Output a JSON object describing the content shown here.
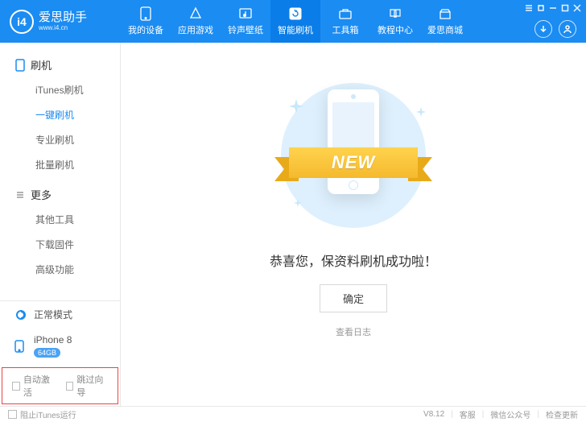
{
  "logo": {
    "mark": "i4",
    "title": "爱思助手",
    "sub": "www.i4.cn"
  },
  "nav": [
    {
      "label": "我的设备"
    },
    {
      "label": "应用游戏"
    },
    {
      "label": "铃声壁纸"
    },
    {
      "label": "智能刷机"
    },
    {
      "label": "工具箱"
    },
    {
      "label": "教程中心"
    },
    {
      "label": "爱思商城"
    }
  ],
  "sidebar": {
    "group1": {
      "title": "刷机",
      "items": [
        "iTunes刷机",
        "一键刷机",
        "专业刷机",
        "批量刷机"
      ]
    },
    "group2": {
      "title": "更多",
      "items": [
        "其他工具",
        "下载固件",
        "高级功能"
      ]
    },
    "mode": "正常模式",
    "device": {
      "name": "iPhone 8",
      "storage": "64GB"
    },
    "opts": {
      "a": "自动激活",
      "b": "跳过向导"
    }
  },
  "main": {
    "ribbon": "NEW",
    "message": "恭喜您，保资料刷机成功啦！",
    "confirm": "确定",
    "log": "查看日志"
  },
  "footer": {
    "block": "阻止iTunes运行",
    "version": "V8.12",
    "links": [
      "客服",
      "微信公众号",
      "检查更新"
    ]
  }
}
